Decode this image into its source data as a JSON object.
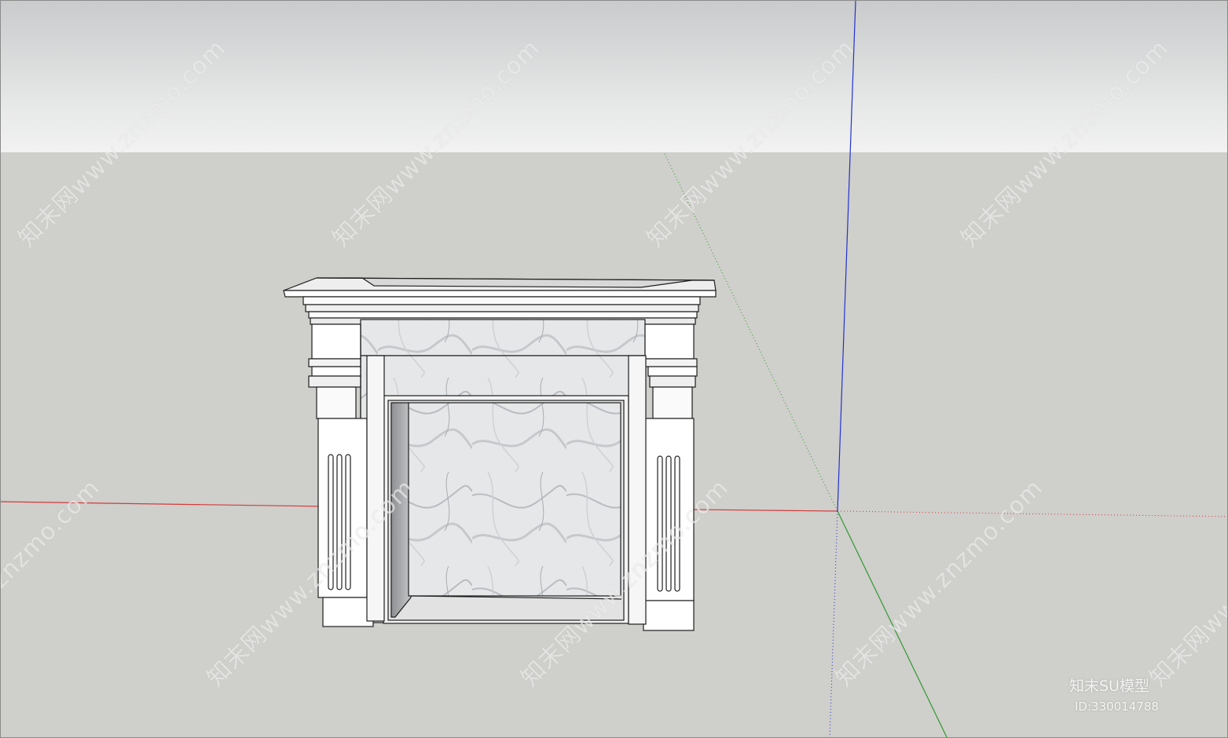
{
  "watermark": {
    "text": "知末网www.znzmo.com",
    "brand": "知末SU模型",
    "id": "ID:330014788"
  },
  "colors": {
    "sky_top": "#c9cbcc",
    "sky_bottom": "#f2f2f2",
    "ground": "#cfcfcb",
    "axis_red": "#d23b3b",
    "axis_green": "#2f9a2f",
    "axis_blue": "#2233cc",
    "marble": "#e8e9ea",
    "outline": "#1e1e1e"
  },
  "scene": {
    "object": "fireplace-mantel",
    "axes": [
      "red-axis",
      "green-axis",
      "blue-axis"
    ]
  }
}
